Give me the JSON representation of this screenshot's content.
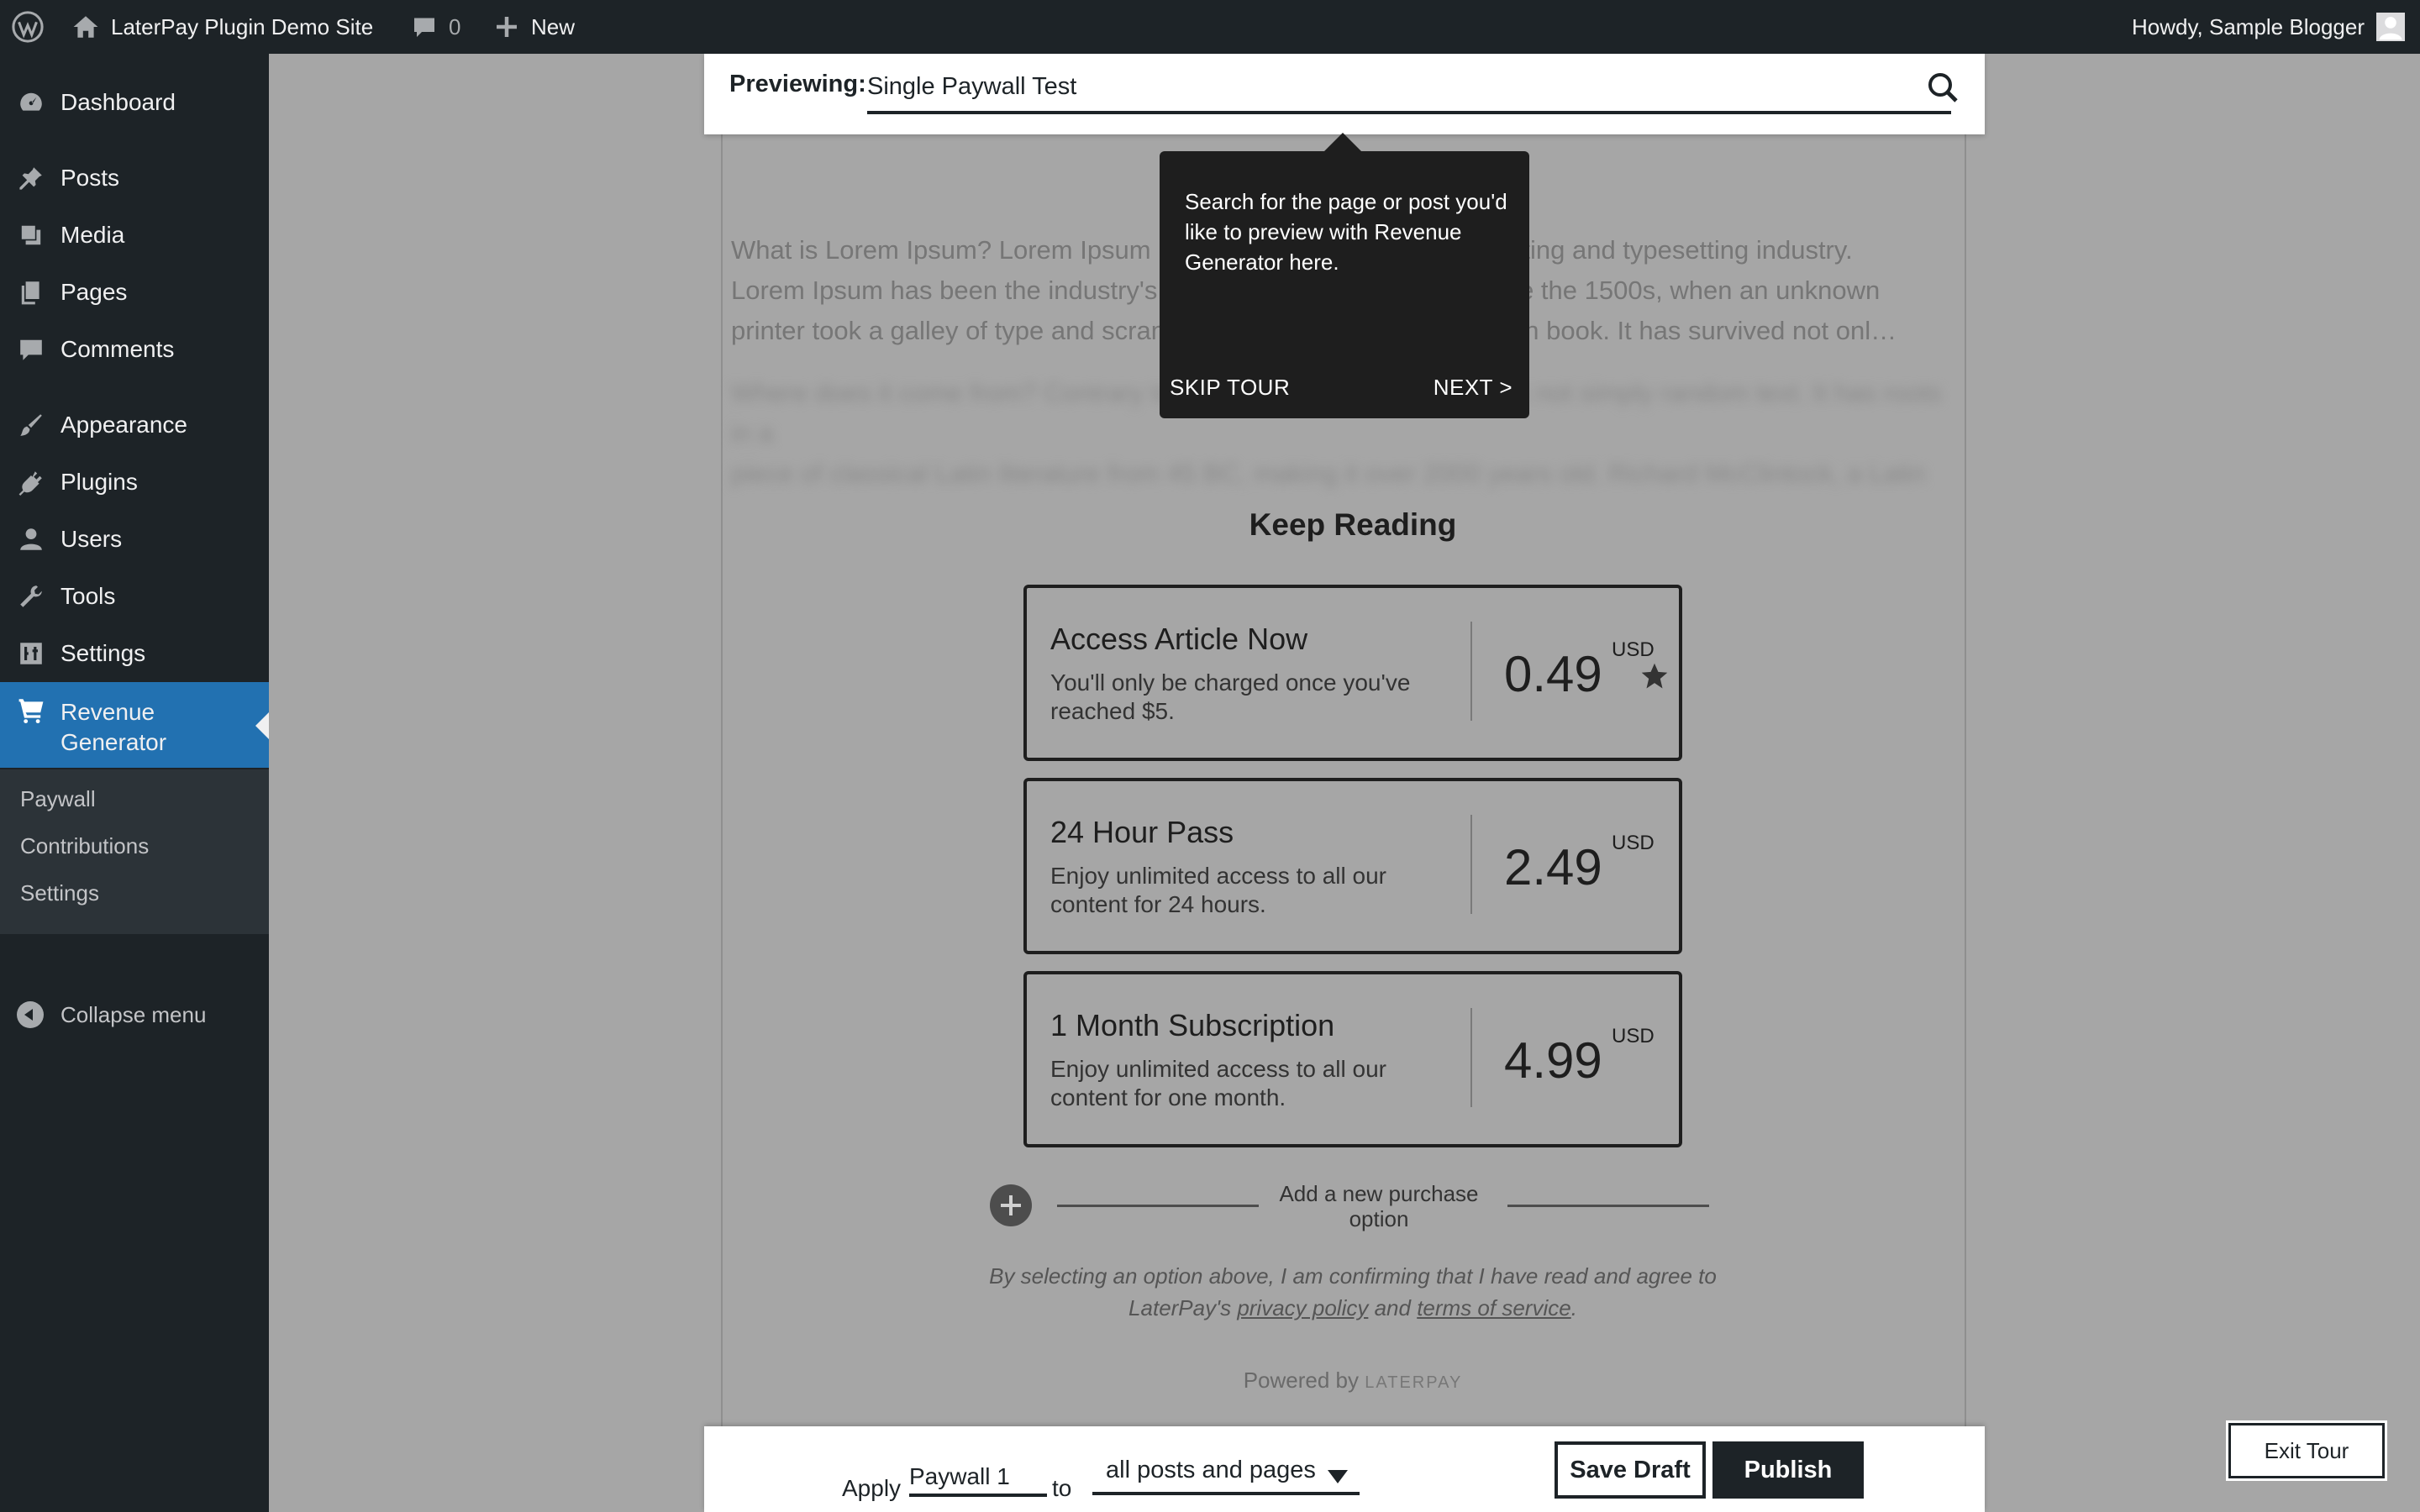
{
  "admin_bar": {
    "site_name": "LaterPay Plugin Demo Site",
    "comments_count": "0",
    "new_label": "New",
    "greeting": "Howdy, Sample Blogger"
  },
  "sidebar": {
    "items": [
      {
        "label": "Dashboard",
        "icon": "dashboard-icon"
      },
      {
        "label": "Posts",
        "icon": "pushpin-icon"
      },
      {
        "label": "Media",
        "icon": "media-icon"
      },
      {
        "label": "Pages",
        "icon": "pages-icon"
      },
      {
        "label": "Comments",
        "icon": "comment-icon"
      },
      {
        "label": "Appearance",
        "icon": "brush-icon"
      },
      {
        "label": "Plugins",
        "icon": "plug-icon"
      },
      {
        "label": "Users",
        "icon": "user-icon"
      },
      {
        "label": "Tools",
        "icon": "wrench-icon"
      },
      {
        "label": "Settings",
        "icon": "sliders-icon"
      },
      {
        "label": "Revenue\nGenerator",
        "icon": "cart-icon"
      }
    ],
    "submenu": [
      "Paywall",
      "Contributions",
      "Settings"
    ],
    "collapse_label": "Collapse menu"
  },
  "preview": {
    "label": "Previewing:",
    "value": "Single Paywall Test"
  },
  "tooltip": {
    "text": "Search for the page or post you'd like to preview with Revenue Generator here.",
    "skip": "SKIP TOUR",
    "next": "NEXT >"
  },
  "article": {
    "paragraph1": "What is Lorem Ipsum? Lorem Ipsum is simply dummy text of the printing and typesetting industry.\nLorem Ipsum has been the industry's standard dummy text ever since the 1500s, when an unknown\nprinter took a galley of type and scrambled it to make a type specimen book. It has survived not onl…",
    "paragraph2": "Where does it come from? Contrary to popular belief, Lorem Ipsum is not simply random text. It has roots in a\npiece of classical Latin literature from 45 BC, making it over 2000 years old. Richard McClintock, a Latin\nprofessor at Hampden-Sydney College in Virginia, looked up one of the more obscure words."
  },
  "paywall": {
    "heading": "Keep Reading",
    "options": [
      {
        "title": "Access Article Now",
        "description": "You'll only be charged once you've reached $5.",
        "price": "0.49",
        "currency": "USD",
        "starred": true
      },
      {
        "title": "24 Hour Pass",
        "description": "Enjoy unlimited access to all our content for 24 hours.",
        "price": "2.49",
        "currency": "USD",
        "starred": false
      },
      {
        "title": "1 Month Subscription",
        "description": "Enjoy unlimited access to all our content for one month.",
        "price": "4.99",
        "currency": "USD",
        "starred": false
      }
    ],
    "add_option_label": "Add a new purchase option",
    "disclaimer_pre": "By selecting an option above, I am confirming that I have read and agree to LaterPay's ",
    "privacy_link": "privacy policy",
    "disclaimer_and": " and ",
    "terms_link": "terms of service",
    "disclaimer_end": ".",
    "powered_by": "Powered by",
    "powered_brand": "LATERPAY"
  },
  "bottom_bar": {
    "apply_label": "Apply",
    "paywall_name": "Paywall 1",
    "to_label": "to",
    "scope": "all posts and pages",
    "save_draft": "Save Draft",
    "publish": "Publish"
  },
  "exit_tour": "Exit Tour",
  "colors": {
    "admin_bg": "#1d2327",
    "accent": "#2271b1",
    "overlay": "#a6a6a6"
  }
}
